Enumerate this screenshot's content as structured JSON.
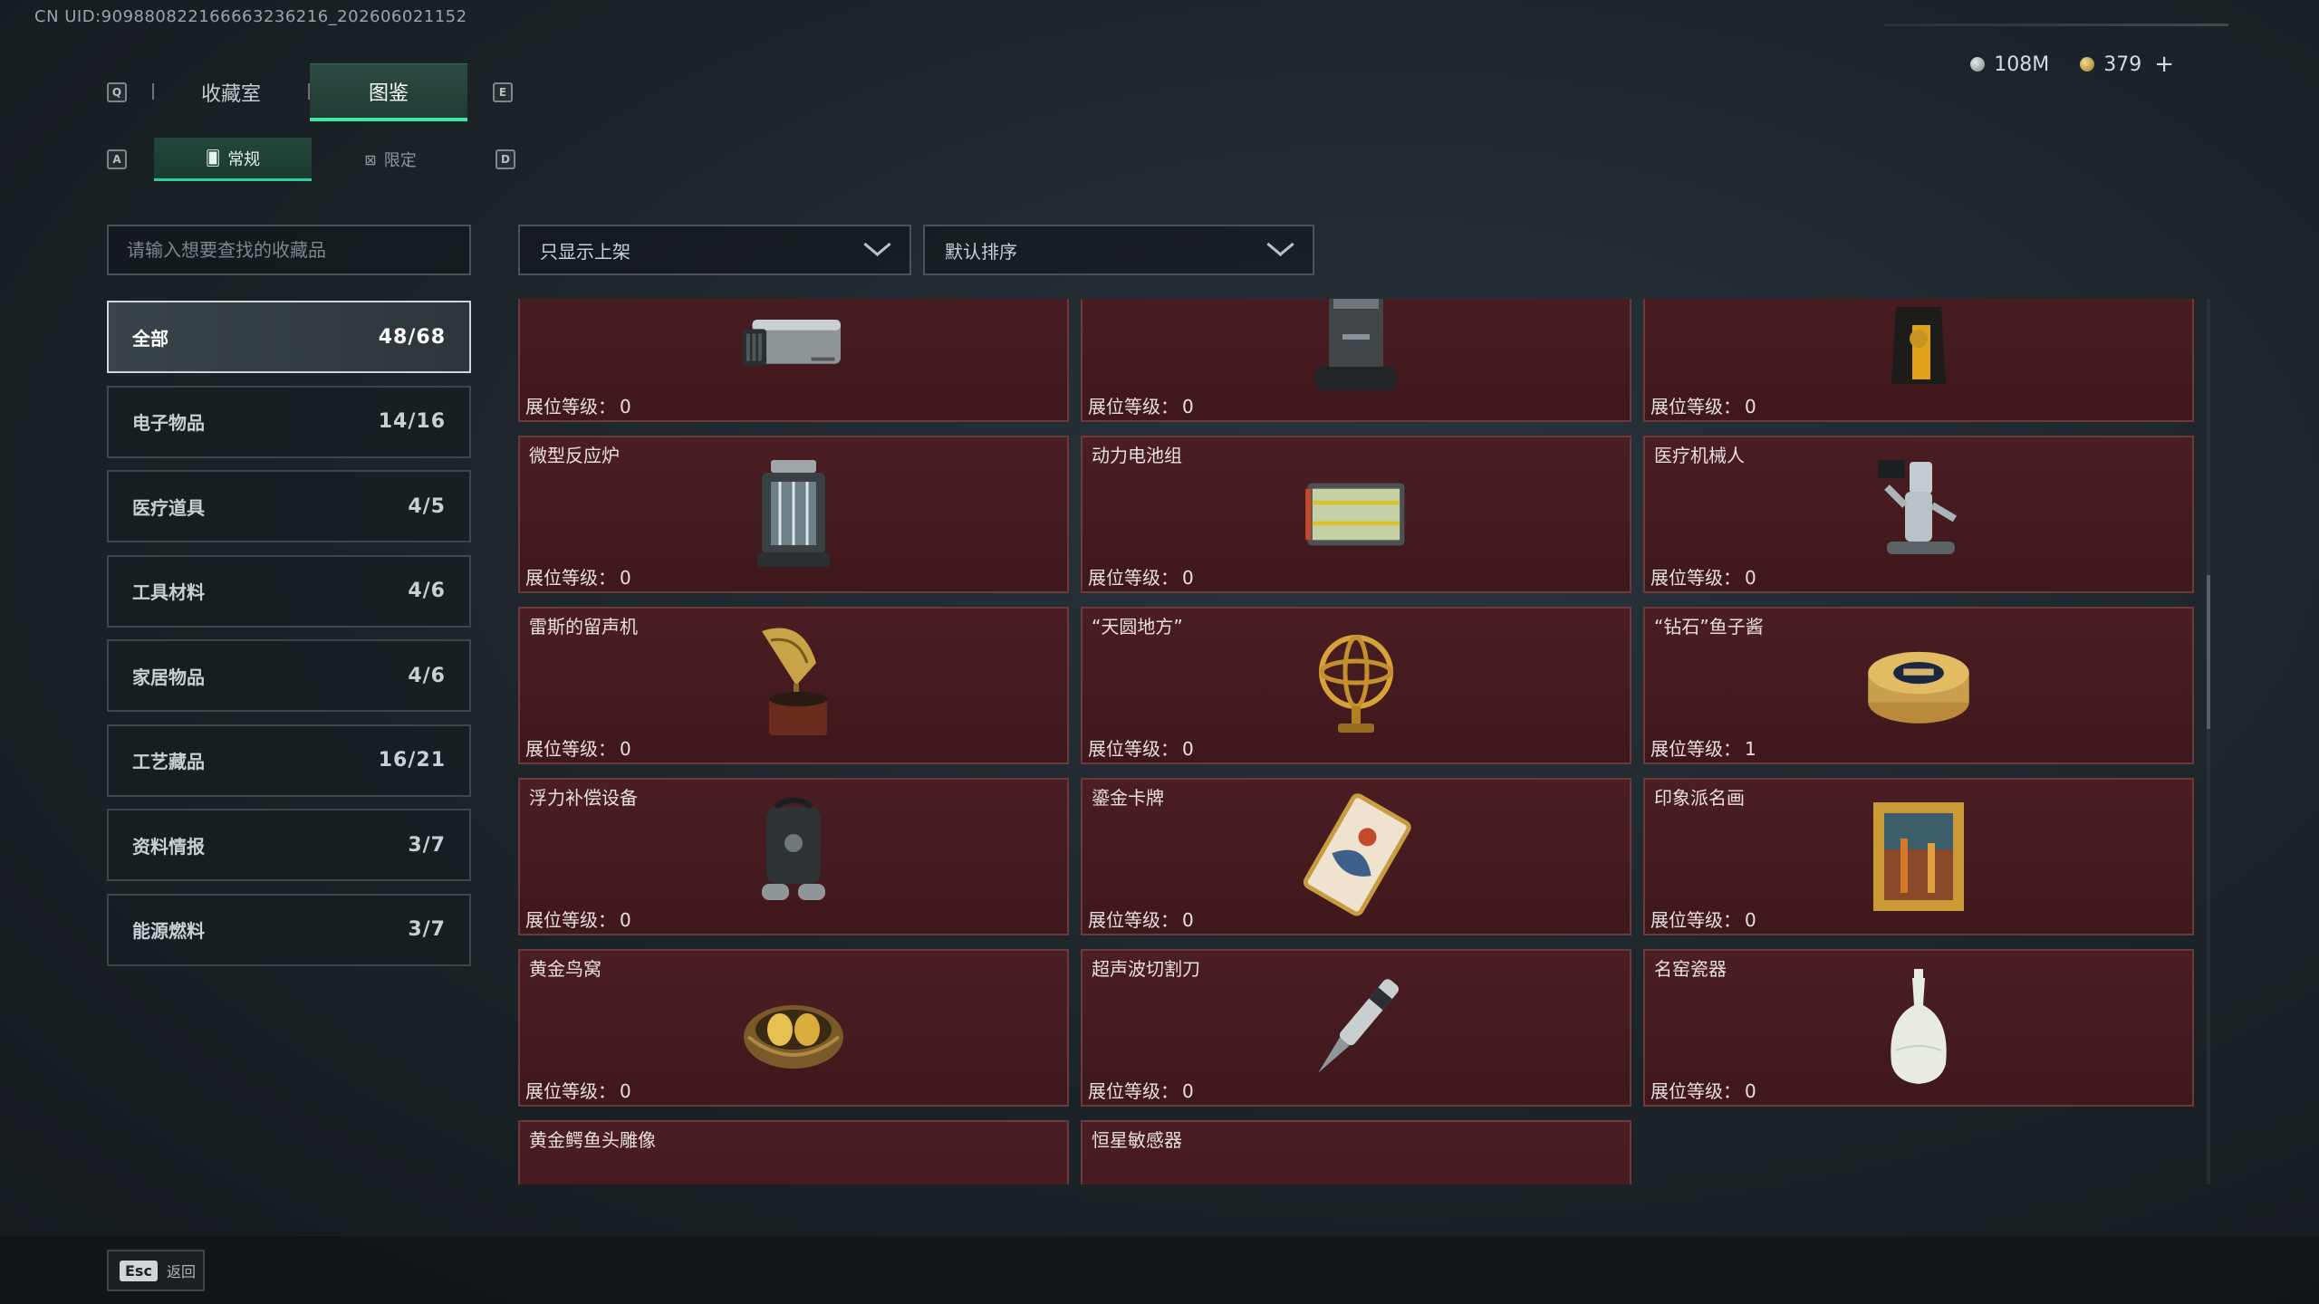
{
  "uid_text": "CN UID:909880822166663236216_202606021152",
  "currency": {
    "silver": "108M",
    "gold": "379",
    "add_label": "+"
  },
  "keys": {
    "prev_tab": "Q",
    "next_tab": "E",
    "prev_sub": "A",
    "next_sub": "D"
  },
  "tabs": [
    {
      "label": "收藏室"
    },
    {
      "label": "图鉴"
    }
  ],
  "subtabs": [
    {
      "label": "常规",
      "icon": "🂠"
    },
    {
      "label": "限定",
      "icon": "⊠"
    }
  ],
  "search": {
    "placeholder": "请输入想要查找的收藏品"
  },
  "categories": [
    {
      "label": "全部",
      "count": "48/68"
    },
    {
      "label": "电子物品",
      "count": "14/16"
    },
    {
      "label": "医疗道具",
      "count": "4/5"
    },
    {
      "label": "工具材料",
      "count": "4/6"
    },
    {
      "label": "家居物品",
      "count": "4/6"
    },
    {
      "label": "工艺藏品",
      "count": "16/21"
    },
    {
      "label": "资料情报",
      "count": "3/7"
    },
    {
      "label": "能源燃料",
      "count": "3/7"
    }
  ],
  "filters": {
    "shelf": "只显示上架",
    "sort": "默认排序"
  },
  "level_label": "展位等级：",
  "items": [
    {
      "name": "",
      "level": "0",
      "icon": "server-icon"
    },
    {
      "name": "",
      "level": "0",
      "icon": "robot-vacuum-icon"
    },
    {
      "name": "",
      "level": "0",
      "icon": "coffee-bag-icon"
    },
    {
      "name": "微型反应炉",
      "level": "0",
      "icon": "reactor-icon"
    },
    {
      "name": "动力电池组",
      "level": "0",
      "icon": "battery-pack-icon"
    },
    {
      "name": "医疗机械人",
      "level": "0",
      "icon": "medical-robot-icon"
    },
    {
      "name": "雷斯的留声机",
      "level": "0",
      "icon": "gramophone-icon"
    },
    {
      "name": "“天圆地方”",
      "level": "0",
      "icon": "armillary-sphere-icon"
    },
    {
      "name": "“钻石”鱼子酱",
      "level": "1",
      "icon": "caviar-tin-icon"
    },
    {
      "name": "浮力补偿设备",
      "level": "0",
      "icon": "buoyancy-device-icon"
    },
    {
      "name": "鎏金卡牌",
      "level": "0",
      "icon": "gilded-card-icon"
    },
    {
      "name": "印象派名画",
      "level": "0",
      "icon": "painting-icon"
    },
    {
      "name": "黄金鸟窝",
      "level": "0",
      "icon": "golden-nest-icon"
    },
    {
      "name": "超声波切割刀",
      "level": "0",
      "icon": "ultrasonic-knife-icon"
    },
    {
      "name": "名窑瓷器",
      "level": "0",
      "icon": "porcelain-vase-icon"
    },
    {
      "name": "黄金鳄鱼头雕像",
      "level": "",
      "icon": "croc-statue-icon"
    },
    {
      "name": "恒星敏感器",
      "level": "",
      "icon": "star-sensor-icon"
    }
  ],
  "bottom": {
    "esc_key": "Esc",
    "back_label": "返回"
  }
}
